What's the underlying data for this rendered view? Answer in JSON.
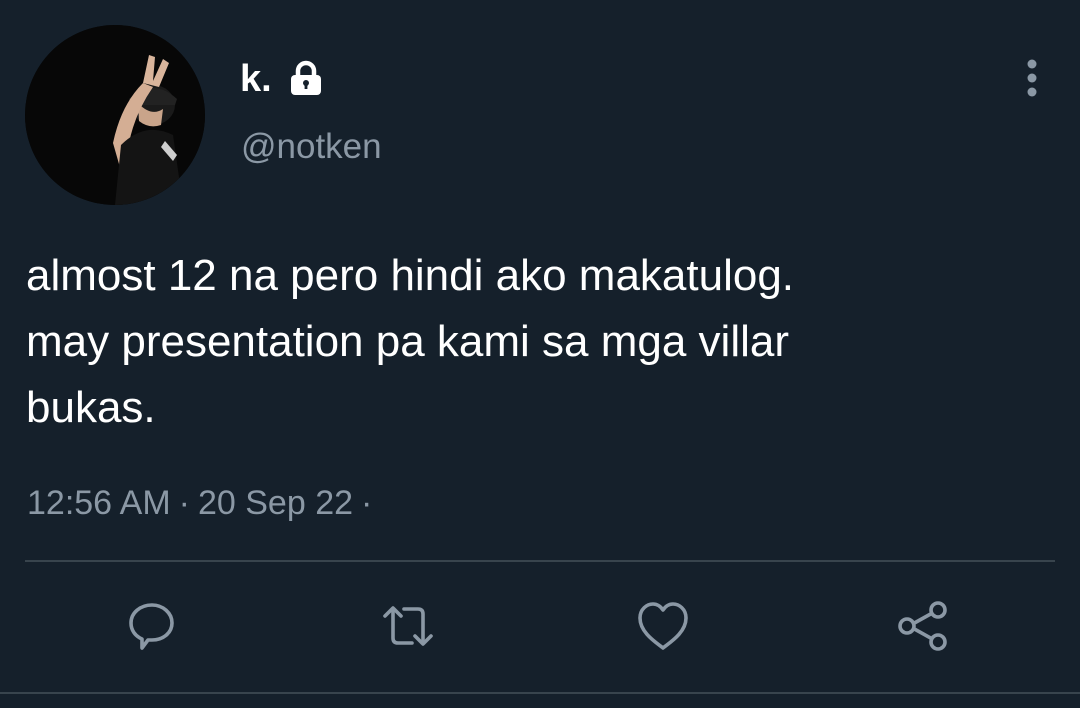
{
  "author": {
    "display_name": "k.",
    "handle": "@notken",
    "protected": true
  },
  "tweet": {
    "text": "almost 12 na pero hindi ako makatulog.\nmay presentation pa kami sa mga villar\nbukas.",
    "time": "12:56 AM",
    "date": "20 Sep 22",
    "separator": "·"
  },
  "icons": {
    "lock": "lock-icon",
    "more": "more-vertical-icon",
    "reply": "reply-icon",
    "retweet": "retweet-icon",
    "like": "heart-icon",
    "share": "share-icon"
  },
  "colors": {
    "background": "#15202b",
    "primary_text": "#ffffff",
    "secondary_text": "#8b98a5",
    "divider": "#38444d"
  }
}
